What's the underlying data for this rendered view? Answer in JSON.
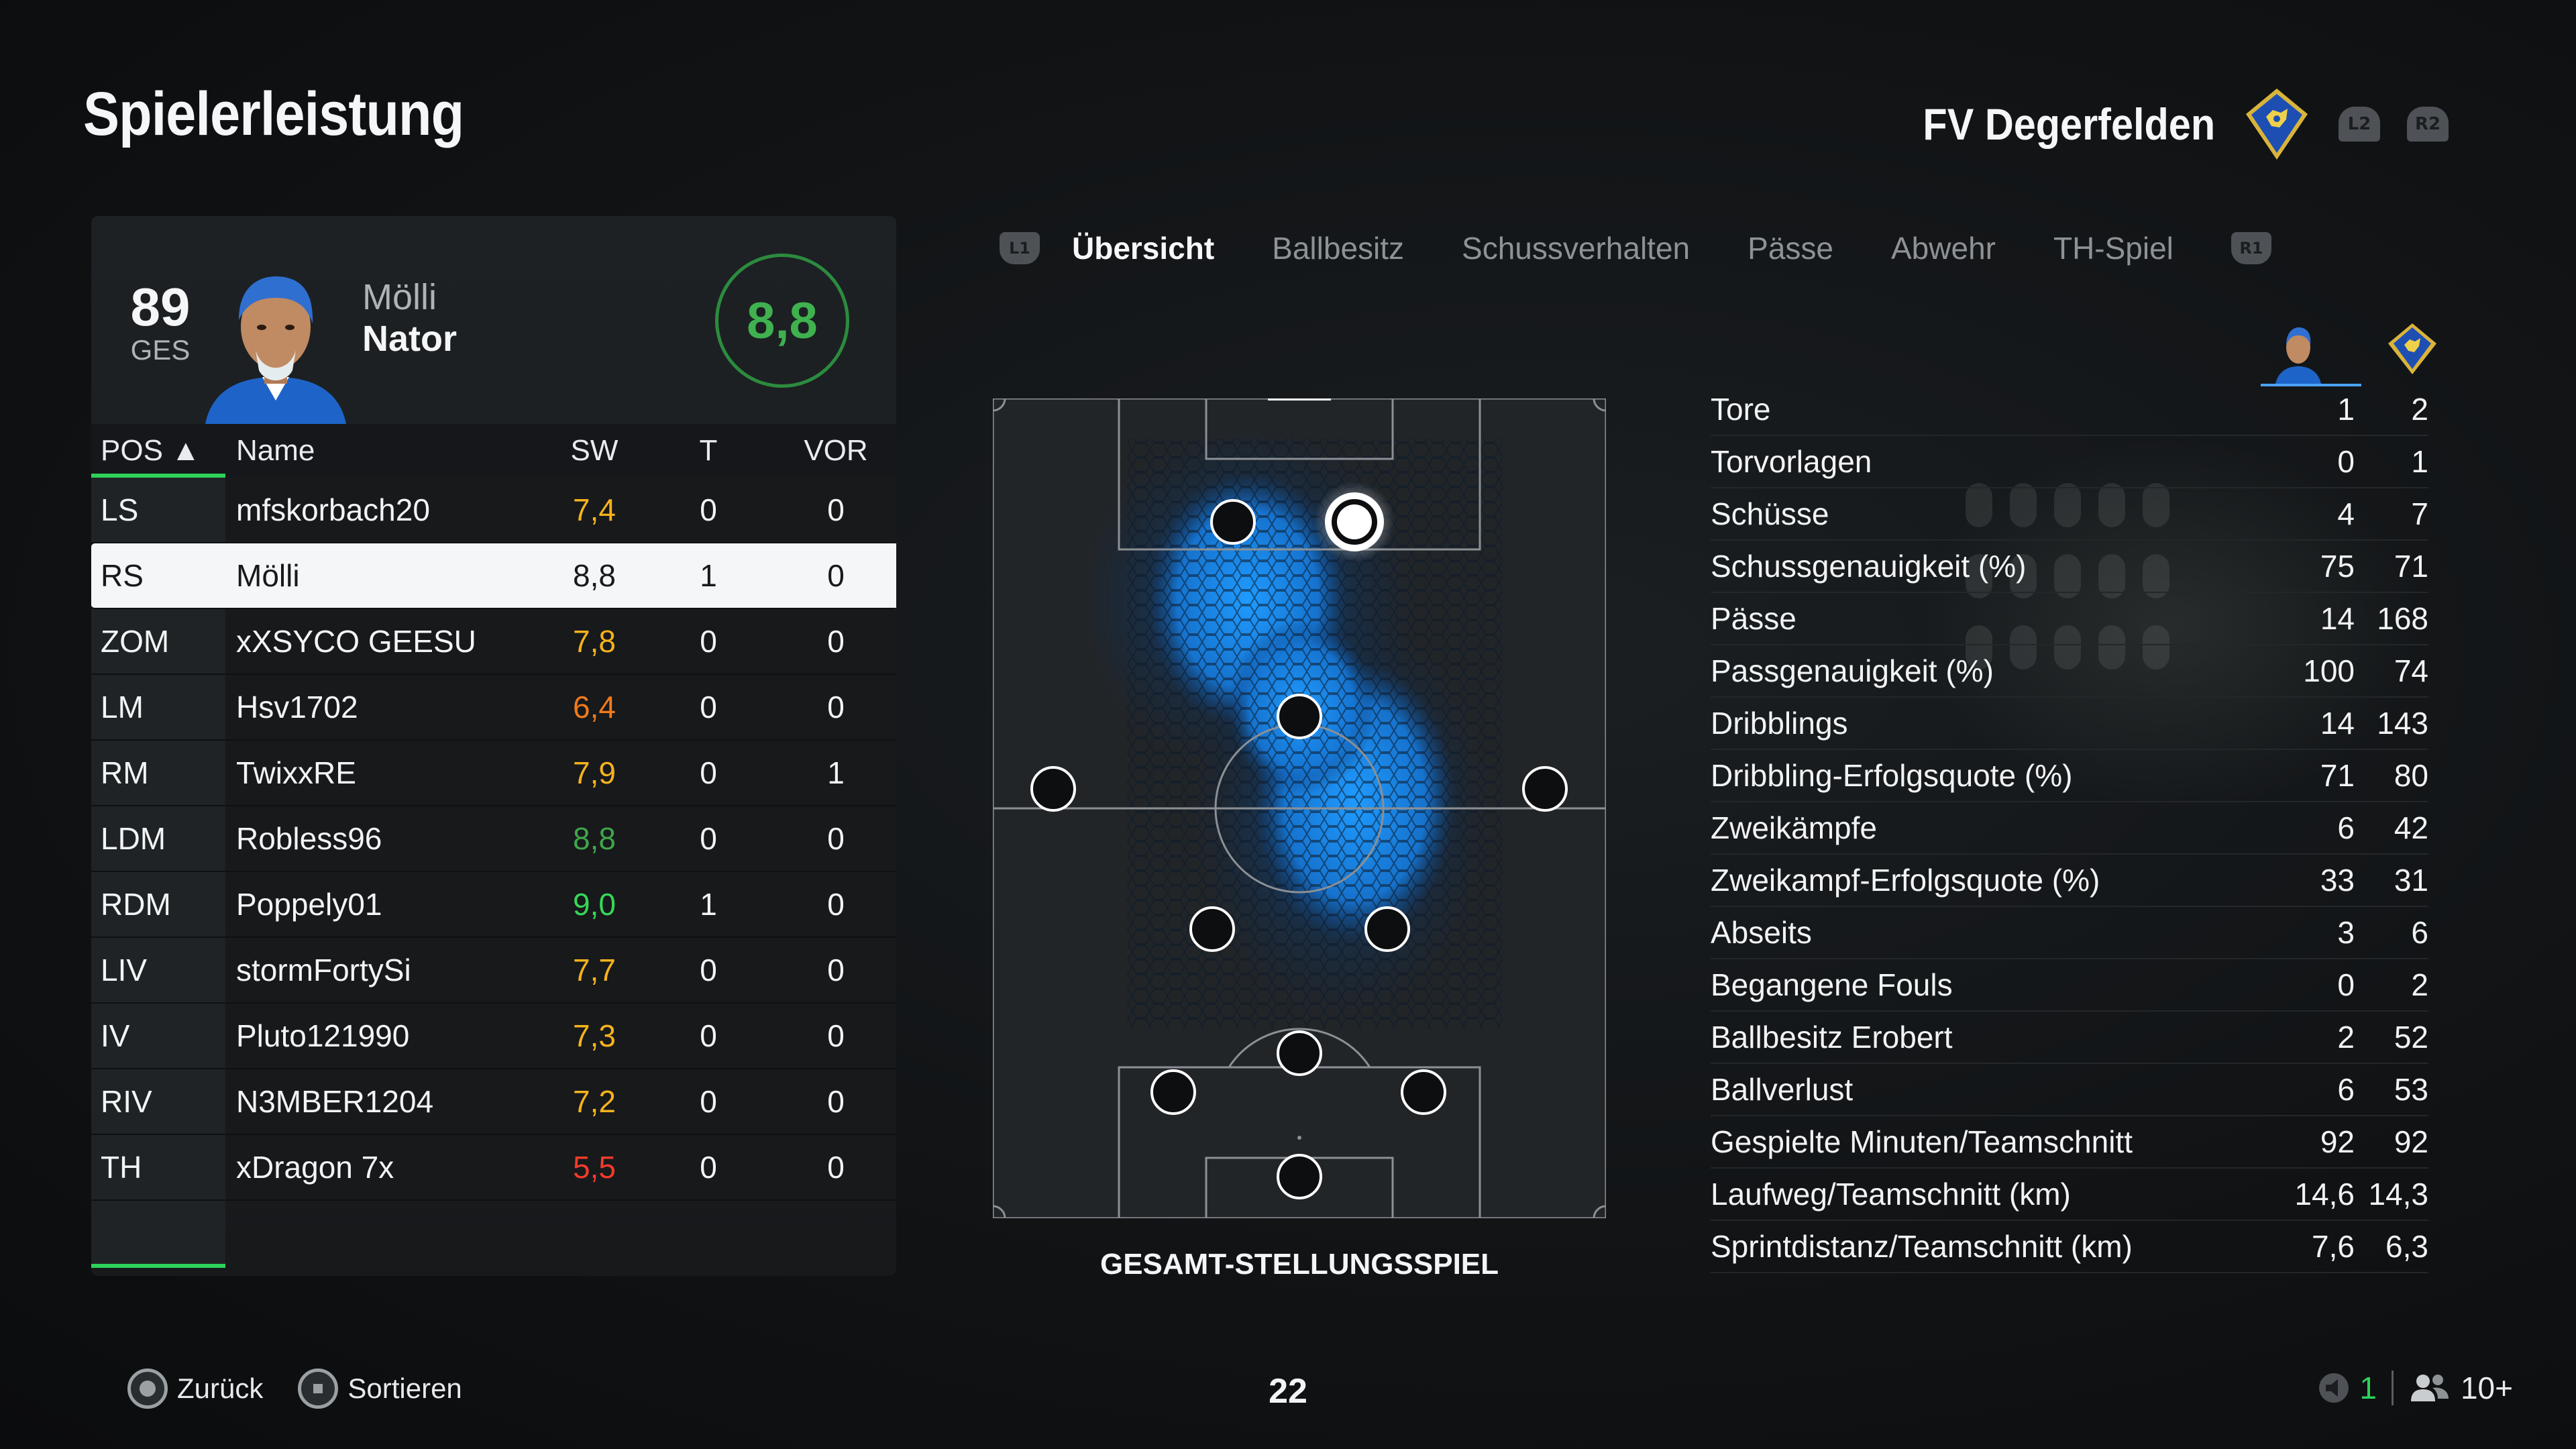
{
  "header": {
    "title": "Spielerleistung",
    "team_name": "FV Degerfelden",
    "buttons": [
      "L2",
      "R2"
    ]
  },
  "player_card": {
    "overall": "89",
    "overall_label": "GES",
    "first_name": "Mölli",
    "last_name": "Nator",
    "match_rating": "8,8"
  },
  "table": {
    "columns": [
      "POS ▲",
      "Name",
      "SW",
      "T",
      "VOR"
    ],
    "rows": [
      {
        "pos": "LS",
        "name": "mfskorbach20",
        "sw": "7,4",
        "t": "0",
        "vor": "0",
        "color": "#f5b21c"
      },
      {
        "pos": "RS",
        "name": "Mölli",
        "sw": "8,8",
        "t": "1",
        "vor": "0",
        "color": "#17191b",
        "selected": true
      },
      {
        "pos": "ZOM",
        "name": "xXSYCO GEESU",
        "sw": "7,8",
        "t": "0",
        "vor": "0",
        "color": "#f5b21c"
      },
      {
        "pos": "LM",
        "name": "Hsv1702",
        "sw": "6,4",
        "t": "0",
        "vor": "0",
        "color": "#f27a1a"
      },
      {
        "pos": "RM",
        "name": "TwixxRE",
        "sw": "7,9",
        "t": "0",
        "vor": "1",
        "color": "#f5b21c"
      },
      {
        "pos": "LDM",
        "name": "Robless96",
        "sw": "8,8",
        "t": "0",
        "vor": "0",
        "color": "#3fa64a"
      },
      {
        "pos": "RDM",
        "name": "Poppely01",
        "sw": "9,0",
        "t": "1",
        "vor": "0",
        "color": "#35d957"
      },
      {
        "pos": "LIV",
        "name": "stormFortySi",
        "sw": "7,7",
        "t": "0",
        "vor": "0",
        "color": "#f5b21c"
      },
      {
        "pos": "IV",
        "name": "Pluto121990",
        "sw": "7,3",
        "t": "0",
        "vor": "0",
        "color": "#f5b21c"
      },
      {
        "pos": "RIV",
        "name": "N3MBER1204",
        "sw": "7,2",
        "t": "0",
        "vor": "0",
        "color": "#f5b21c"
      },
      {
        "pos": "TH",
        "name": "xDragon 7x",
        "sw": "5,5",
        "t": "0",
        "vor": "0",
        "color": "#f23a2a"
      }
    ]
  },
  "tabs": {
    "left_button": "L1",
    "right_button": "R1",
    "items": [
      "Übersicht",
      "Ballbesitz",
      "Schussverhalten",
      "Pässe",
      "Abwehr",
      "TH-Spiel"
    ],
    "active": 0
  },
  "pitch": {
    "caption": "GESAMT-STELLUNGSSPIEL",
    "heatmap_color": "#2b8fe8"
  },
  "stats": [
    {
      "label": "Tore",
      "player": "1",
      "team": "2"
    },
    {
      "label": "Torvorlagen",
      "player": "0",
      "team": "1"
    },
    {
      "label": "Schüsse",
      "player": "4",
      "team": "7"
    },
    {
      "label": "Schussgenauigkeit (%)",
      "player": "75",
      "team": "71"
    },
    {
      "label": "Pässe",
      "player": "14",
      "team": "168"
    },
    {
      "label": "Passgenauigkeit (%)",
      "player": "100",
      "team": "74"
    },
    {
      "label": "Dribblings",
      "player": "14",
      "team": "143"
    },
    {
      "label": "Dribbling-Erfolgsquote (%)",
      "player": "71",
      "team": "80"
    },
    {
      "label": "Zweikämpfe",
      "player": "6",
      "team": "42"
    },
    {
      "label": "Zweikampf-Erfolgsquote (%)",
      "player": "33",
      "team": "31"
    },
    {
      "label": "Abseits",
      "player": "3",
      "team": "6"
    },
    {
      "label": "Begangene Fouls",
      "player": "0",
      "team": "2"
    },
    {
      "label": "Ballbesitz Erobert",
      "player": "2",
      "team": "52"
    },
    {
      "label": "Ballverlust",
      "player": "6",
      "team": "53"
    },
    {
      "label": "Gespielte Minuten/Teamschnitt",
      "player": "92",
      "team": "92"
    },
    {
      "label": "Laufweg/Teamschnitt (km)",
      "player": "14,6",
      "team": "14,3"
    },
    {
      "label": "Sprintdistanz/Teamschnitt (km)",
      "player": "7,6",
      "team": "6,3"
    }
  ],
  "footer": {
    "back_label": "Zurück",
    "sort_label": "Sortieren",
    "center_number": "22",
    "mic_count": "1",
    "players_count": "10+"
  },
  "colors": {
    "accent_green": "#2ed15a",
    "ring_green": "#2c8b3e"
  }
}
